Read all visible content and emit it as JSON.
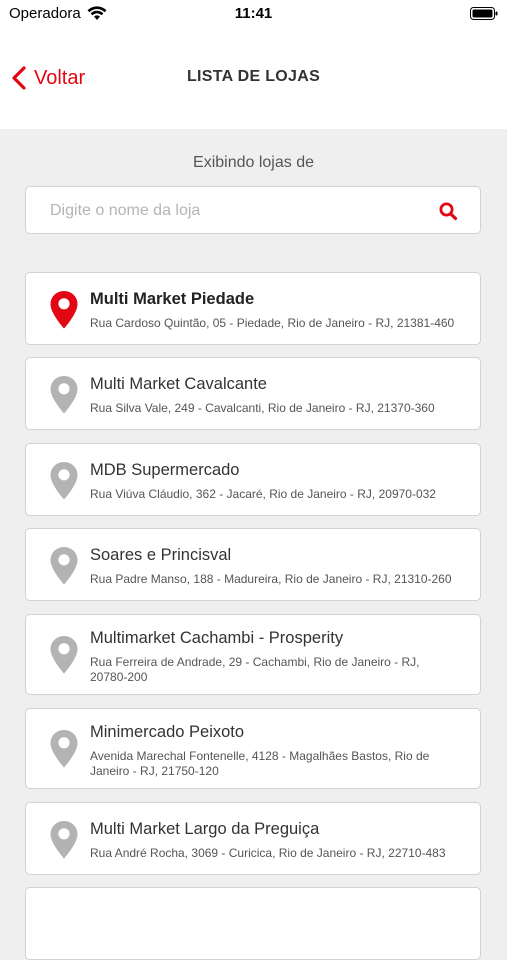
{
  "status_bar": {
    "carrier": "Operadora",
    "time": "11:41"
  },
  "nav": {
    "back_label": "Voltar",
    "title": "LISTA DE LOJAS"
  },
  "filter": {
    "showing_label": "Exibindo lojas de"
  },
  "search": {
    "placeholder": "Digite o nome da loja",
    "value": ""
  },
  "colors": {
    "accent": "#e30613",
    "pin_inactive": "#b3b3b3",
    "background": "#efefef"
  },
  "stores": [
    {
      "name": "Multi Market Piedade",
      "address": "Rua Cardoso Quintão, 05 - Piedade, Rio de Janeiro - RJ, 21381-460",
      "selected": true
    },
    {
      "name": "Multi Market Cavalcante",
      "address": "Rua Silva Vale, 249 - Cavalcanti, Rio de Janeiro - RJ, 21370-360",
      "selected": false
    },
    {
      "name": "MDB Supermercado",
      "address": "Rua Viúva Cláudio, 362 - Jacaré, Rio de Janeiro - RJ, 20970-032",
      "selected": false
    },
    {
      "name": "Soares e Princisval",
      "address": "Rua Padre Manso, 188 - Madureira, Rio de Janeiro - RJ, 21310-260",
      "selected": false
    },
    {
      "name": "Multimarket Cachambi - Prosperity",
      "address": "Rua Ferreira de Andrade, 29 - Cachambi, Rio de Janeiro - RJ, 20780-200",
      "selected": false
    },
    {
      "name": "Minimercado Peixoto",
      "address": "Avenida Marechal Fontenelle, 4128 - Magalhães Bastos, Rio de Janeiro - RJ, 21750-120",
      "selected": false
    },
    {
      "name": "Multi Market Largo da Preguiça",
      "address": "Rua André Rocha, 3069 - Curicica, Rio de Janeiro - RJ, 22710-483",
      "selected": false
    }
  ]
}
